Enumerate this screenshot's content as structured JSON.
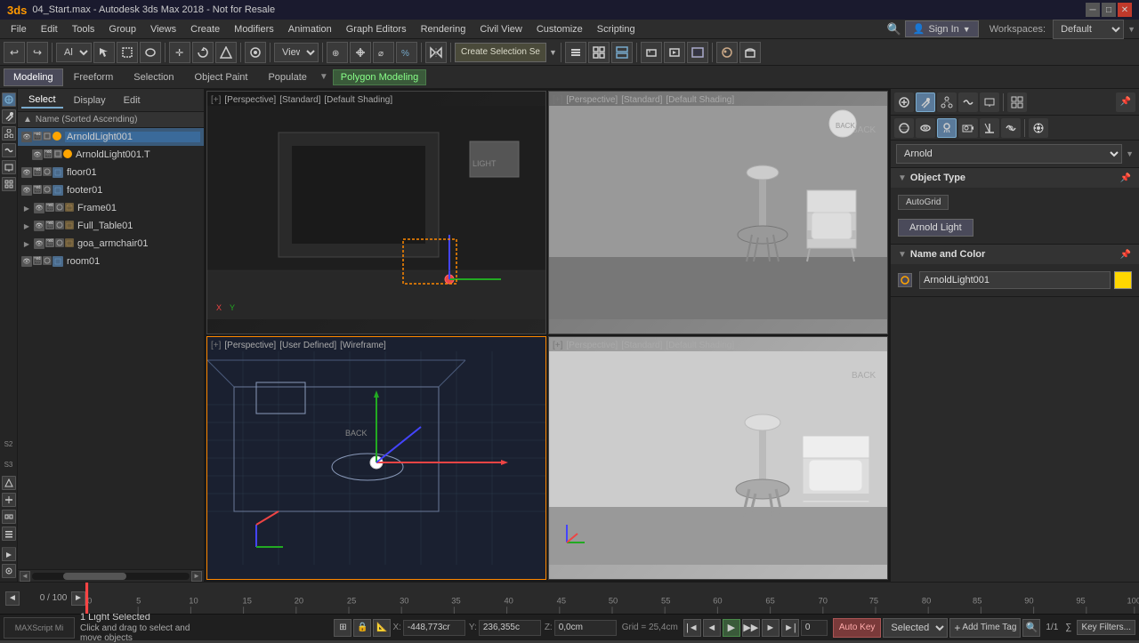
{
  "titlebar": {
    "title": "04_Start.max - Autodesk 3ds Max 2018 - Not for Resale",
    "min": "─",
    "max": "□",
    "close": "✕"
  },
  "menubar": {
    "items": [
      "File",
      "Edit",
      "Tools",
      "Group",
      "Views",
      "Create",
      "Modifiers",
      "Animation",
      "Graph Editors",
      "Rendering",
      "Civil View",
      "Customize",
      "Scripting"
    ],
    "workspaces_label": "Workspaces:",
    "workspace_value": "Default",
    "signin": "Sign In"
  },
  "toolbar": {
    "undo_icon": "↩",
    "redo_icon": "↪",
    "select_label": "All",
    "view_label": "View",
    "create_selection": "Create Selection Se"
  },
  "subtabs": {
    "items": [
      "Modeling",
      "Freeform",
      "Selection",
      "Object Paint",
      "Populate"
    ],
    "active": "Modeling",
    "polygon_label": "Polygon Modeling"
  },
  "scene_explorer": {
    "tabs": [
      "Select",
      "Display",
      "Edit"
    ],
    "sort_label": "Name (Sorted Ascending)",
    "items": [
      {
        "name": "ArnoldLight001",
        "type": "light",
        "indent": 0,
        "selected": true
      },
      {
        "name": "ArnoldLight001.T",
        "type": "light",
        "indent": 1,
        "selected": false
      },
      {
        "name": "floor01",
        "type": "mesh",
        "indent": 0,
        "selected": false
      },
      {
        "name": "footer01",
        "type": "mesh",
        "indent": 0,
        "selected": false
      },
      {
        "name": "Frame01",
        "type": "group",
        "indent": 0,
        "selected": false,
        "expanded": true
      },
      {
        "name": "Full_Table01",
        "type": "group",
        "indent": 0,
        "selected": false,
        "expanded": false
      },
      {
        "name": "goa_armchair01",
        "type": "group",
        "indent": 0,
        "selected": false,
        "expanded": false
      },
      {
        "name": "room01",
        "type": "mesh",
        "indent": 0,
        "selected": false
      }
    ]
  },
  "viewports": [
    {
      "id": "vp1",
      "label": "[+] [Perspective] [Standard] [Default Shading]",
      "type": "perspective",
      "active": false
    },
    {
      "id": "vp2",
      "label": "[+] [Perspective] [Standard] [Default Shading]",
      "type": "perspective2",
      "active": false
    },
    {
      "id": "vp3",
      "label": "[+] [Perspective] [User Defined] [Wireframe]",
      "type": "wireframe",
      "active": true
    },
    {
      "id": "vp4",
      "label": "[+] [Perspective] [Standard] [Default Shading]",
      "type": "perspective3",
      "active": false
    }
  ],
  "right_panel": {
    "renderer_label": "Arnold",
    "object_type_title": "Object Type",
    "autogrid_label": "AutoGrid",
    "arnold_light_label": "Arnold Light",
    "name_color_title": "Name and Color",
    "object_name": "ArnoldLight001",
    "color_swatch": "#ffd700"
  },
  "timeline": {
    "current_frame": "0",
    "total_frames": "100",
    "display": "0 / 100",
    "ticks": [
      "0",
      "5",
      "10",
      "15",
      "20",
      "25",
      "30",
      "35",
      "40",
      "45",
      "50",
      "55",
      "60",
      "65",
      "70",
      "75",
      "80",
      "85",
      "90",
      "95",
      "100"
    ]
  },
  "statusbar": {
    "script_label": "MAXScript Mi",
    "selected_count": "1 Light Selected",
    "hint": "Click and drag to select and move objects",
    "x_label": "X:",
    "x_val": "-448,773cr",
    "y_label": "Y:",
    "y_val": "236,355c",
    "z_label": "Z:",
    "z_val": "0,0cm",
    "grid_label": "Grid = 25,4cm",
    "autokey_label": "Auto Key",
    "selected_label": "Selected",
    "key_filters_label": "Key Filters...",
    "add_time_tag": "Add Time Tag",
    "frame_display": "0"
  }
}
